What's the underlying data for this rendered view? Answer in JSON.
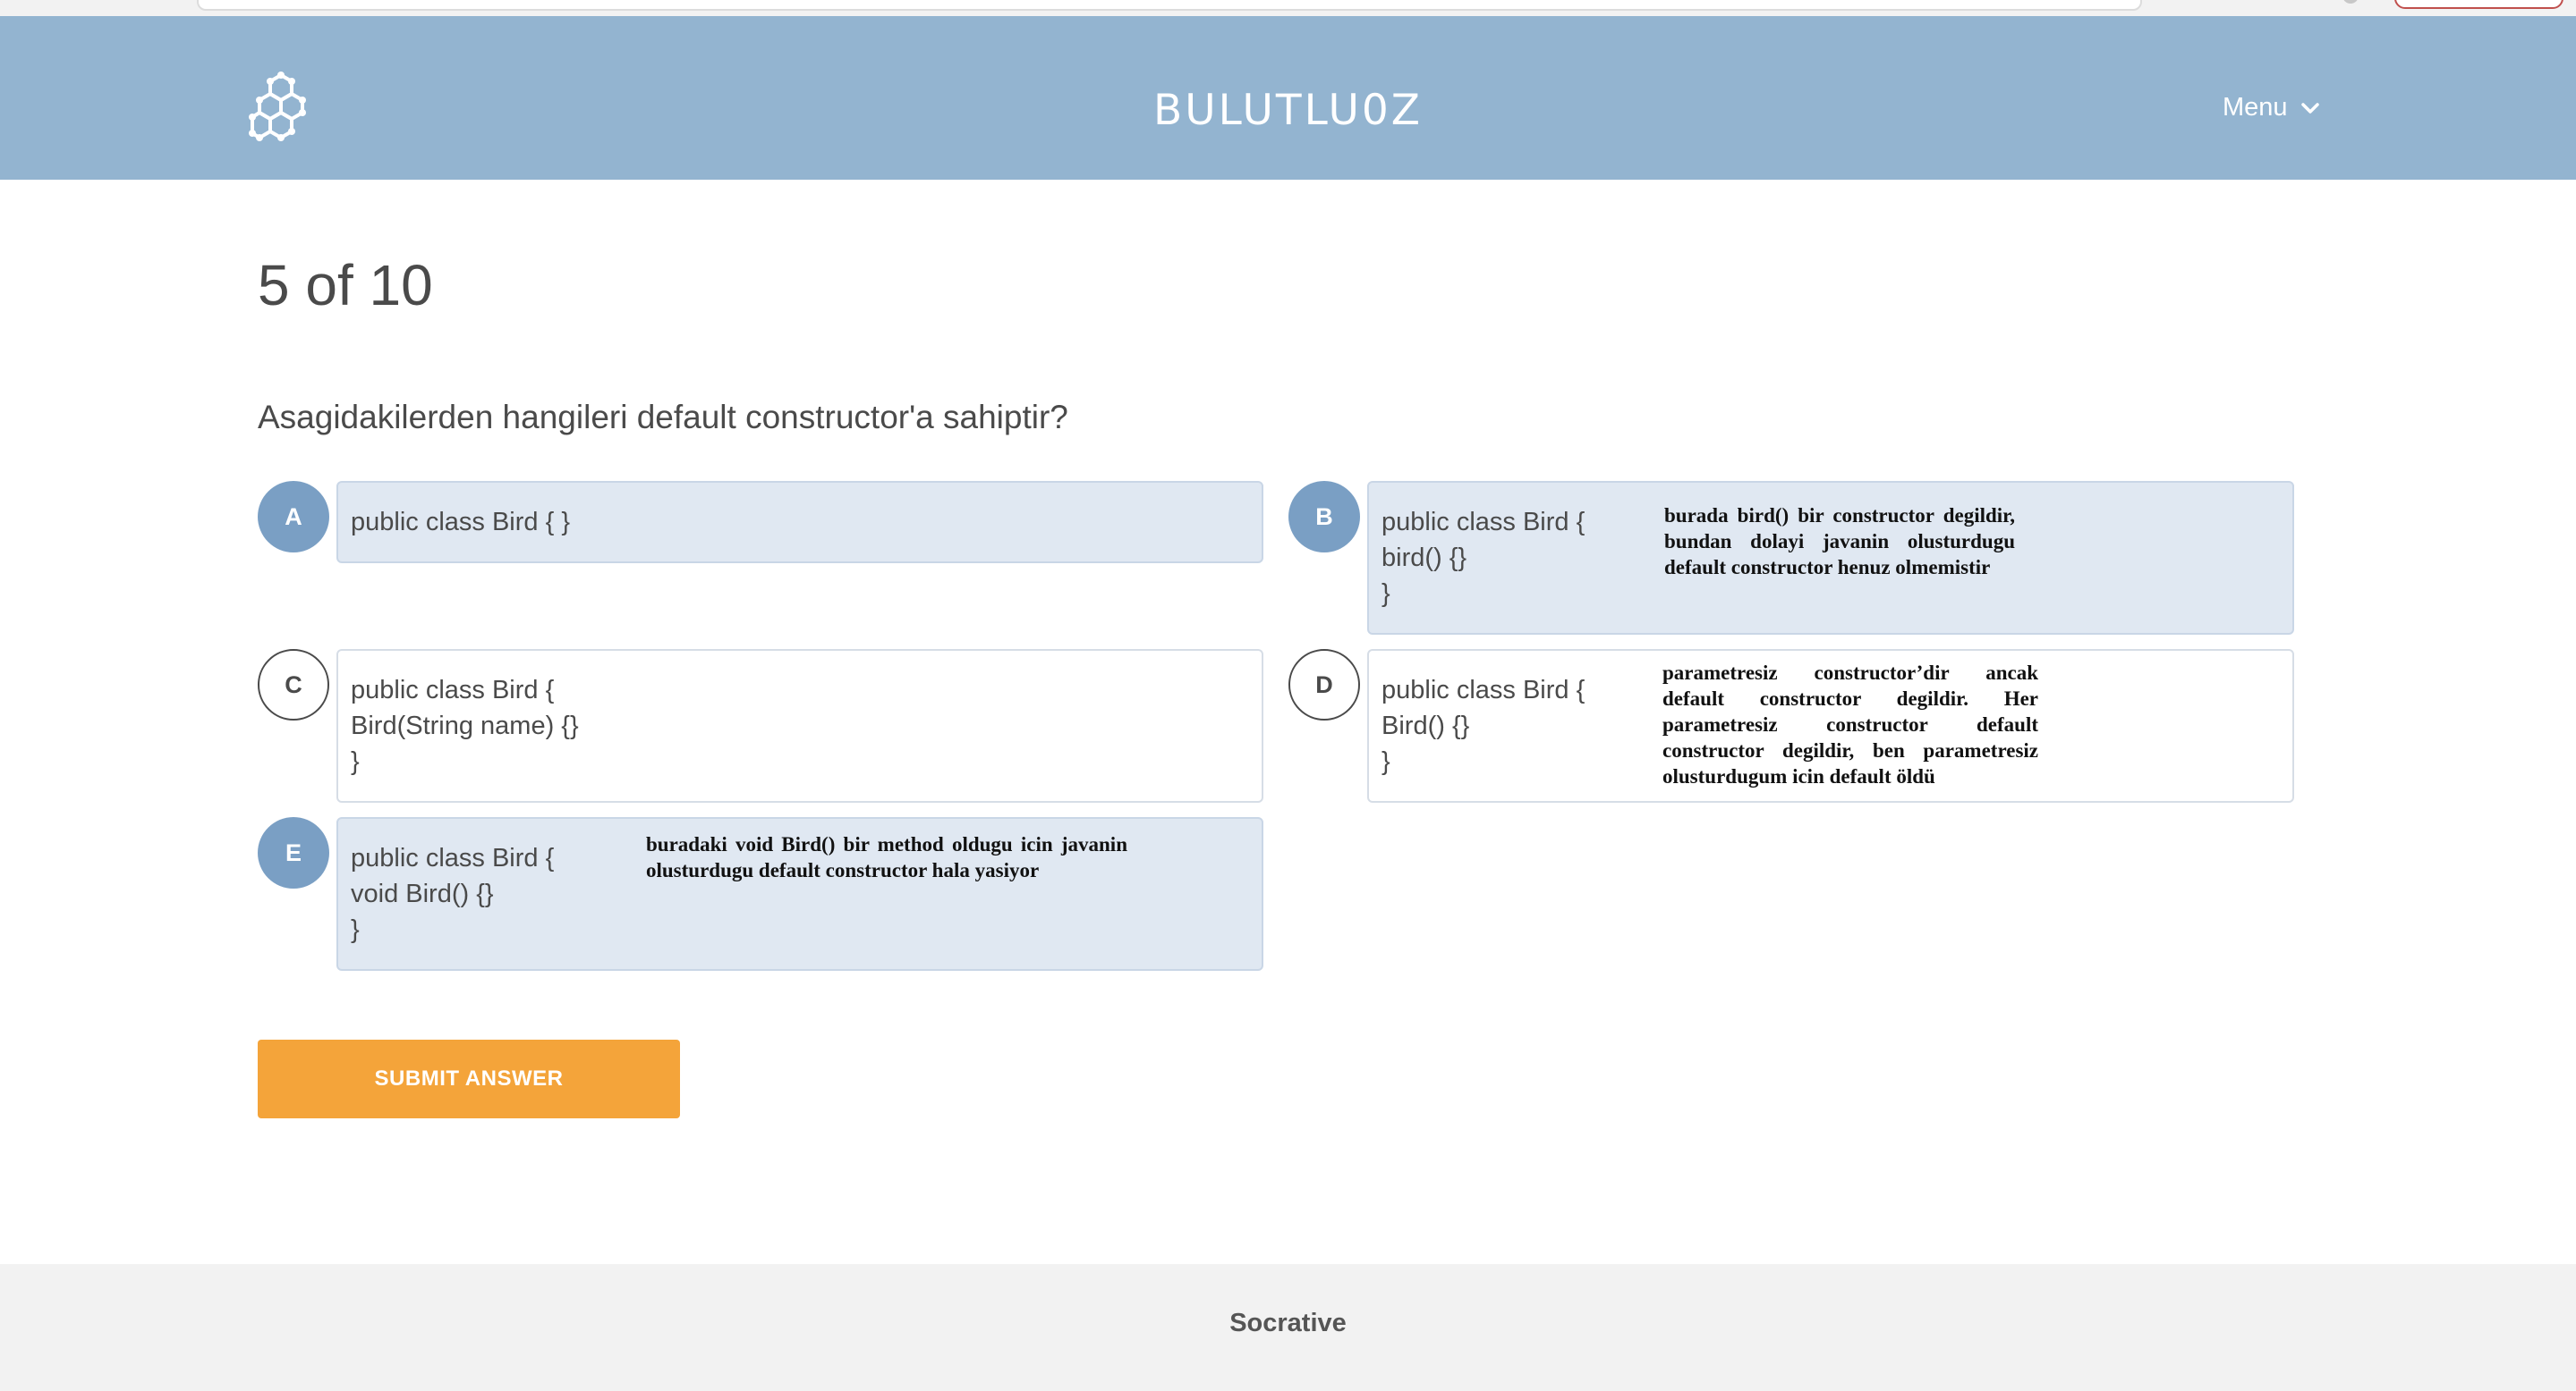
{
  "header": {
    "brand": "BULUTLU0Z",
    "menu_label": "Menu",
    "background_color": "#93b4d0"
  },
  "quiz": {
    "progress": "5 of 10",
    "question": "Asagidakilerden hangileri default constructor'a sahiptir?",
    "choices": [
      {
        "letter": "A",
        "selected": true,
        "code": "public class Bird { }",
        "note": ""
      },
      {
        "letter": "B",
        "selected": true,
        "code": "public class Bird {\nbird() {}\n}",
        "note": "burada bird() bir constructor degildir, bundan dolayi javanin olusturdugu default constructor henuz olmemistir"
      },
      {
        "letter": "C",
        "selected": false,
        "code": "public class Bird {\nBird(String name) {}\n}",
        "note": ""
      },
      {
        "letter": "D",
        "selected": false,
        "code": "public class Bird {\nBird() {}\n}",
        "note": "parametresiz constructor’dir ancak default constructor degildir. Her parametresiz constructor default constructor degildir, ben parametresiz olusturdugum icin default öldü"
      },
      {
        "letter": "E",
        "selected": true,
        "code": "public class Bird {\nvoid Bird() {}\n}",
        "note": "buradaki void Bird() bir method oldugu icin javanin olusturdugu default constructor hala yasiyor"
      }
    ],
    "submit_label": "SUBMIT ANSWER",
    "accent_color": "#f4a43a",
    "selected_color": "#7a9fc4"
  },
  "footer": {
    "text": "Socrative"
  }
}
